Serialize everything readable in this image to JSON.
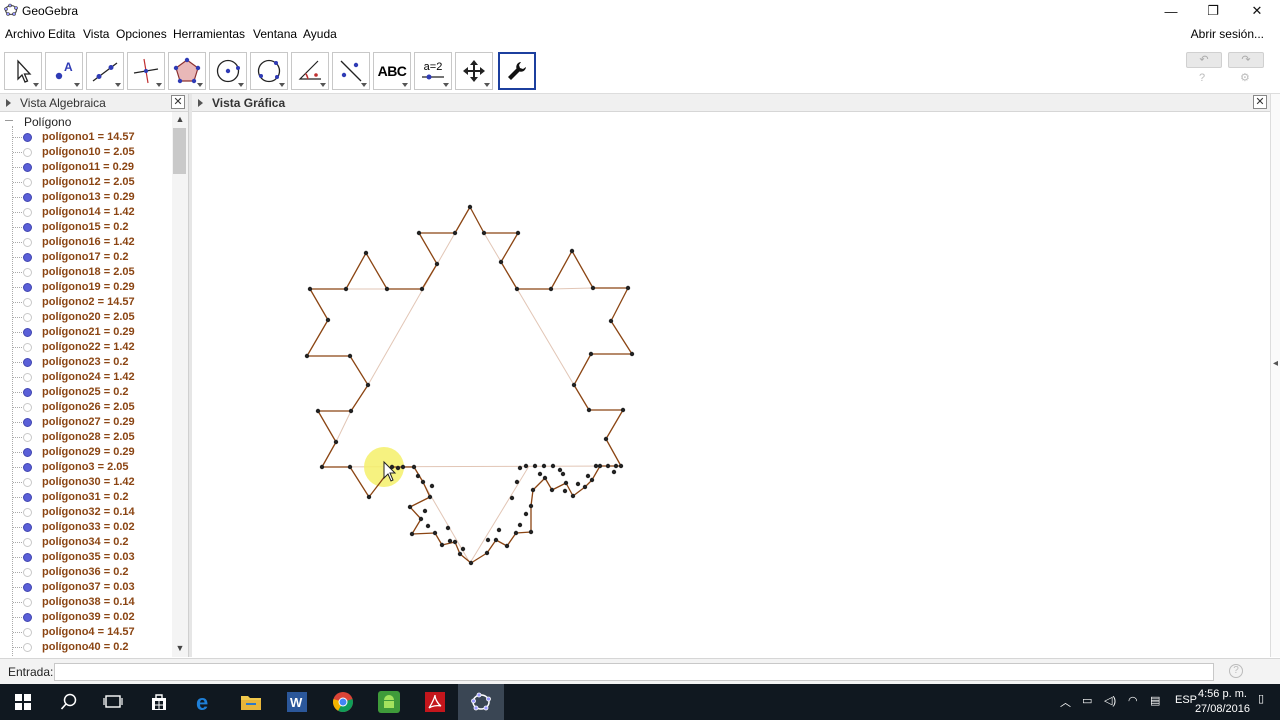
{
  "window": {
    "title": "GeoGebra"
  },
  "menu": {
    "items": [
      {
        "label": "Archivo"
      },
      {
        "label": "Edita"
      },
      {
        "label": "Vista"
      },
      {
        "label": "Opciones"
      },
      {
        "label": "Herramientas"
      },
      {
        "label": "Ventana"
      },
      {
        "label": "Ayuda"
      }
    ],
    "login": "Abrir sesión..."
  },
  "toolbar": {
    "tools": [
      {
        "icon": "move-arrow-icon"
      },
      {
        "icon": "point-icon"
      },
      {
        "icon": "line-icon"
      },
      {
        "icon": "perpendicular-icon"
      },
      {
        "icon": "polygon-icon"
      },
      {
        "icon": "circle-icon"
      },
      {
        "icon": "ellipse-icon"
      },
      {
        "icon": "angle-icon"
      },
      {
        "icon": "reflect-icon"
      },
      {
        "icon": "text-icon",
        "label": "ABC"
      },
      {
        "icon": "slider-icon",
        "label": "a=2"
      },
      {
        "icon": "move-graphics-icon"
      },
      {
        "icon": "wrench-icon"
      }
    ],
    "undo": "↶",
    "redo": "↷"
  },
  "algebra": {
    "header": "Vista Algebraica",
    "group": "Polígono",
    "items": [
      {
        "label": "polígono1 = 14.57",
        "visible": true
      },
      {
        "label": "polígono10 = 2.05",
        "visible": false
      },
      {
        "label": "polígono11 = 0.29",
        "visible": true
      },
      {
        "label": "polígono12 = 2.05",
        "visible": false
      },
      {
        "label": "polígono13 = 0.29",
        "visible": true
      },
      {
        "label": "polígono14 = 1.42",
        "visible": false
      },
      {
        "label": "polígono15 = 0.2",
        "visible": true
      },
      {
        "label": "polígono16 = 1.42",
        "visible": false
      },
      {
        "label": "polígono17 = 0.2",
        "visible": true
      },
      {
        "label": "polígono18 = 2.05",
        "visible": false
      },
      {
        "label": "polígono19 = 0.29",
        "visible": true
      },
      {
        "label": "polígono2 = 14.57",
        "visible": false
      },
      {
        "label": "polígono20 = 2.05",
        "visible": false
      },
      {
        "label": "polígono21 = 0.29",
        "visible": true
      },
      {
        "label": "polígono22 = 1.42",
        "visible": false
      },
      {
        "label": "polígono23 = 0.2",
        "visible": true
      },
      {
        "label": "polígono24 = 1.42",
        "visible": false
      },
      {
        "label": "polígono25 = 0.2",
        "visible": true
      },
      {
        "label": "polígono26 = 2.05",
        "visible": false
      },
      {
        "label": "polígono27 = 0.29",
        "visible": true
      },
      {
        "label": "polígono28 = 2.05",
        "visible": false
      },
      {
        "label": "polígono29 = 0.29",
        "visible": true
      },
      {
        "label": "polígono3 = 2.05",
        "visible": true
      },
      {
        "label": "polígono30 = 1.42",
        "visible": false
      },
      {
        "label": "polígono31 = 0.2",
        "visible": true
      },
      {
        "label": "polígono32 = 0.14",
        "visible": false
      },
      {
        "label": "polígono33 = 0.02",
        "visible": true
      },
      {
        "label": "polígono34 = 0.2",
        "visible": false
      },
      {
        "label": "polígono35 = 0.03",
        "visible": true
      },
      {
        "label": "polígono36 = 0.2",
        "visible": false
      },
      {
        "label": "polígono37 = 0.03",
        "visible": true
      },
      {
        "label": "polígono38 = 0.14",
        "visible": false
      },
      {
        "label": "polígono39 = 0.02",
        "visible": true
      },
      {
        "label": "polígono4 = 14.57",
        "visible": false
      },
      {
        "label": "polígono40 = 0.2",
        "visible": false
      }
    ]
  },
  "graphics": {
    "header": "Vista Gráfica",
    "shape_color": "#8b4513",
    "point_color": "#222222",
    "cursor_highlight": "#f5f06a"
  },
  "input": {
    "label": "Entrada:",
    "value": ""
  },
  "taskbar": {
    "apps": [
      "windows-start-icon",
      "search-icon",
      "task-view-icon",
      "store-icon",
      "edge-icon",
      "explorer-icon",
      "word-icon",
      "chrome-icon",
      "android-icon",
      "acrobat-icon",
      "geogebra-icon"
    ],
    "lang": "ESP",
    "time": "4:56 p. m.",
    "date": "27/08/2016"
  }
}
